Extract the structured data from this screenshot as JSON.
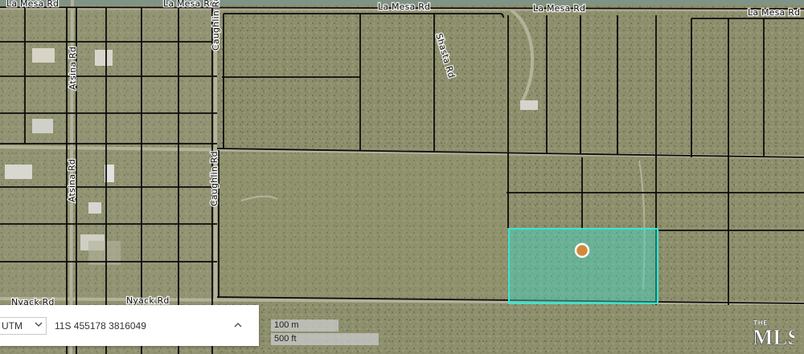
{
  "map": {
    "type": "satellite parcel map",
    "roads": [
      {
        "id": "la-mesa-w",
        "label": "La Mesa Rd"
      },
      {
        "id": "la-mesa-c",
        "label": "La Mesa Rd"
      },
      {
        "id": "la-mesa-e1",
        "label": "La Mesa Rd"
      },
      {
        "id": "la-mesa-e2",
        "label": "La Mesa Rd"
      },
      {
        "id": "la-mesa-s",
        "label": "La Mesa Rd"
      },
      {
        "id": "atsina-1",
        "label": "Atsina Rd"
      },
      {
        "id": "atsina-2",
        "label": "Atsina Rd"
      },
      {
        "id": "caughlin-1",
        "label": "Caughlin Rd"
      },
      {
        "id": "caughlin-2",
        "label": "Caughlin Rd"
      },
      {
        "id": "shasta",
        "label": "Shasta Rd"
      },
      {
        "id": "nyack-w",
        "label": "Nyack Rd"
      },
      {
        "id": "nyack-c",
        "label": "Nyack Rd"
      }
    ],
    "highlight_color": "#3fd9c8",
    "marker_color": "#d08a3a"
  },
  "coord_bar": {
    "system": "UTM",
    "value": "11S 455178 3816049"
  },
  "scale": {
    "metric": "100 m",
    "imperial": "500 ft"
  },
  "logo": {
    "top": "THE",
    "main": "MLS",
    "mark": "™"
  }
}
